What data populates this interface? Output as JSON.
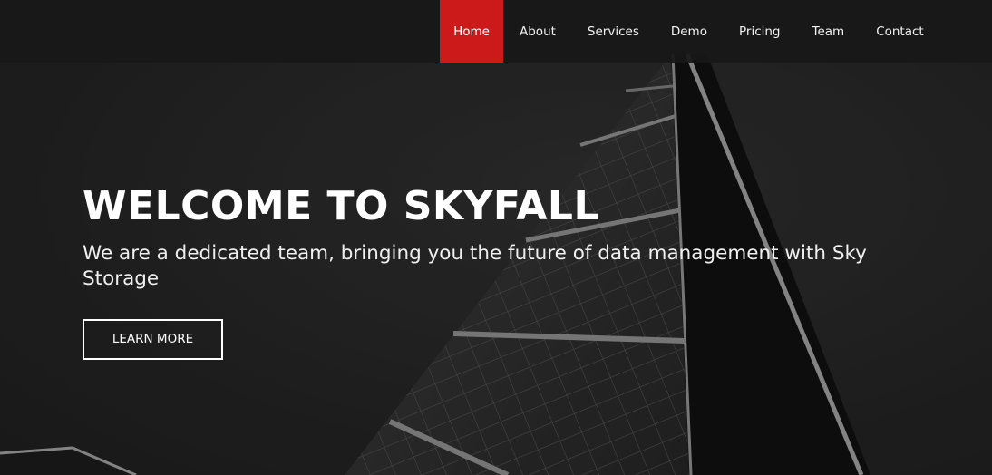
{
  "nav": {
    "items": [
      {
        "label": "Home",
        "active": true
      },
      {
        "label": "About",
        "active": false
      },
      {
        "label": "Services",
        "active": false
      },
      {
        "label": "Demo",
        "active": false
      },
      {
        "label": "Pricing",
        "active": false
      },
      {
        "label": "Team",
        "active": false
      },
      {
        "label": "Contact",
        "active": false
      }
    ],
    "active_color": "#cc1a1a",
    "bar_color": "#181818"
  },
  "hero": {
    "title": "WELCOME TO SKYFALL",
    "subtitle": "We are a dedicated team, bringing you the future of data management with Sky Storage",
    "cta_label": "LEARN MORE",
    "background_image": "grayscale-glass-skyscraper-image"
  }
}
